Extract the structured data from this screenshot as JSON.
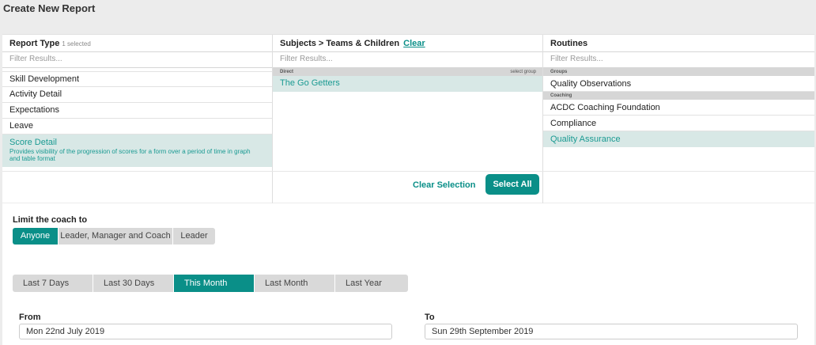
{
  "page": {
    "title": "Create New Report"
  },
  "report_type": {
    "header": "Report Type",
    "selected_count": "1 selected",
    "filter_placeholder": "Filter Results...",
    "items": [
      {
        "label": "Skill Development"
      },
      {
        "label": "Activity Detail"
      },
      {
        "label": "Expectations"
      },
      {
        "label": "Leave"
      },
      {
        "label": "Score Detail",
        "description": "Provides visibility of the progression of scores for a form over a period of time in graph and table format",
        "selected": true
      }
    ]
  },
  "subjects": {
    "header": "Subjects > Teams & Children",
    "clear_label": "Clear",
    "filter_placeholder": "Filter Results...",
    "group": {
      "label": "Direct",
      "action": "select group"
    },
    "items": [
      {
        "label": "The Go Getters",
        "selected": true
      }
    ]
  },
  "routines": {
    "header": "Routines",
    "filter_placeholder": "Filter Results...",
    "groups": [
      {
        "label": "Groups",
        "items": [
          {
            "label": "Quality Observations"
          }
        ]
      },
      {
        "label": "Coaching",
        "items": [
          {
            "label": "ACDC Coaching Foundation"
          },
          {
            "label": "Compliance"
          },
          {
            "label": "Quality Assurance",
            "selected": true
          }
        ]
      }
    ]
  },
  "actions": {
    "clear_selection": "Clear Selection",
    "select_all": "Select All"
  },
  "limit_coach": {
    "label": "Limit the coach to",
    "options": [
      "Anyone",
      "Leader, Manager and Coach",
      "Leader"
    ],
    "selected": "Anyone"
  },
  "date_range": {
    "options": [
      "Last 7 Days",
      "Last 30 Days",
      "This Month",
      "Last Month",
      "Last Year"
    ],
    "selected": "This Month"
  },
  "from": {
    "label": "From",
    "value": "Mon 22nd July 2019"
  },
  "to": {
    "label": "To",
    "value": "Sun 29th September 2019"
  },
  "colors": {
    "accent": "#0a8f88",
    "selected_bg": "#d8e8e6",
    "segment_bg": "#d9d9d9"
  }
}
